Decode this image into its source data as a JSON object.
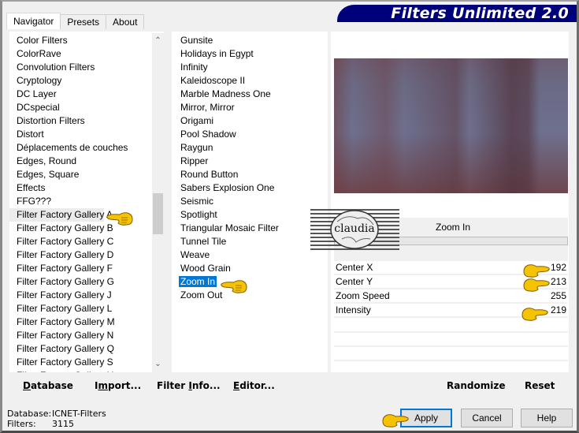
{
  "window": {
    "title": "Filters Unlimited 2.0",
    "title_color": "#00007b"
  },
  "tabs": [
    {
      "label": "Navigator",
      "active": true
    },
    {
      "label": "Presets",
      "active": false
    },
    {
      "label": "About",
      "active": false
    }
  ],
  "categories": {
    "items": [
      "Color Filters",
      "ColorRave",
      "Convolution Filters",
      "Cryptology",
      "DC Layer",
      "DCspecial",
      "Distortion Filters",
      "Distort",
      "Déplacements de couches",
      "Edges, Round",
      "Edges, Square",
      "Effects",
      "FFG???",
      "Filter Factory Gallery A",
      "Filter Factory Gallery B",
      "Filter Factory Gallery C",
      "Filter Factory Gallery D",
      "Filter Factory Gallery F",
      "Filter Factory Gallery G",
      "Filter Factory Gallery J",
      "Filter Factory Gallery L",
      "Filter Factory Gallery M",
      "Filter Factory Gallery N",
      "Filter Factory Gallery Q",
      "Filter Factory Gallery S",
      "Filter Factory Gallery U"
    ],
    "highlighted": "Filter Factory Gallery A",
    "scroll_up_icon": "chevron-up-icon",
    "scroll_down_icon": "chevron-down-icon"
  },
  "filters": {
    "items": [
      "Gunsite",
      "Holidays in Egypt",
      "Infinity",
      "Kaleidoscope II",
      "Marble Madness One",
      "Mirror, Mirror",
      "Origami",
      "Pool Shadow",
      "Raygun",
      "Ripper",
      "Round Button",
      "Sabers Explosion One",
      "Seismic",
      "Spotlight",
      "Triangular Mosaic Filter",
      "Tunnel Tile",
      "Weave",
      "Wood Grain",
      "Zoom In",
      "Zoom Out"
    ],
    "selected": "Zoom In",
    "selection_color": "#0078d7"
  },
  "preview": {
    "filter_name": "Zoom In"
  },
  "parameters": [
    {
      "label": "Center X",
      "value": "192"
    },
    {
      "label": "Center Y",
      "value": "213"
    },
    {
      "label": "Zoom Speed",
      "value": "255"
    },
    {
      "label": "Intensity",
      "value": "219"
    }
  ],
  "left_buttons": {
    "database": {
      "pre": "",
      "u": "D",
      "post": "atabase"
    },
    "import": {
      "pre": "I",
      "u": "m",
      "post": "port..."
    },
    "filter_info": {
      "pre": "Filter ",
      "u": "I",
      "post": "nfo..."
    },
    "editor": {
      "pre": "",
      "u": "E",
      "post": "ditor..."
    }
  },
  "right_buttons": {
    "randomize": "Randomize",
    "reset": "Reset"
  },
  "status": {
    "database_label": "Database:",
    "database_value": "ICNET-Filters",
    "filters_label": "Filters:",
    "filters_value": "3115"
  },
  "dialog_buttons": {
    "apply": "Apply",
    "cancel": "Cancel",
    "help": "Help"
  },
  "watermark": {
    "text": "claudia"
  }
}
